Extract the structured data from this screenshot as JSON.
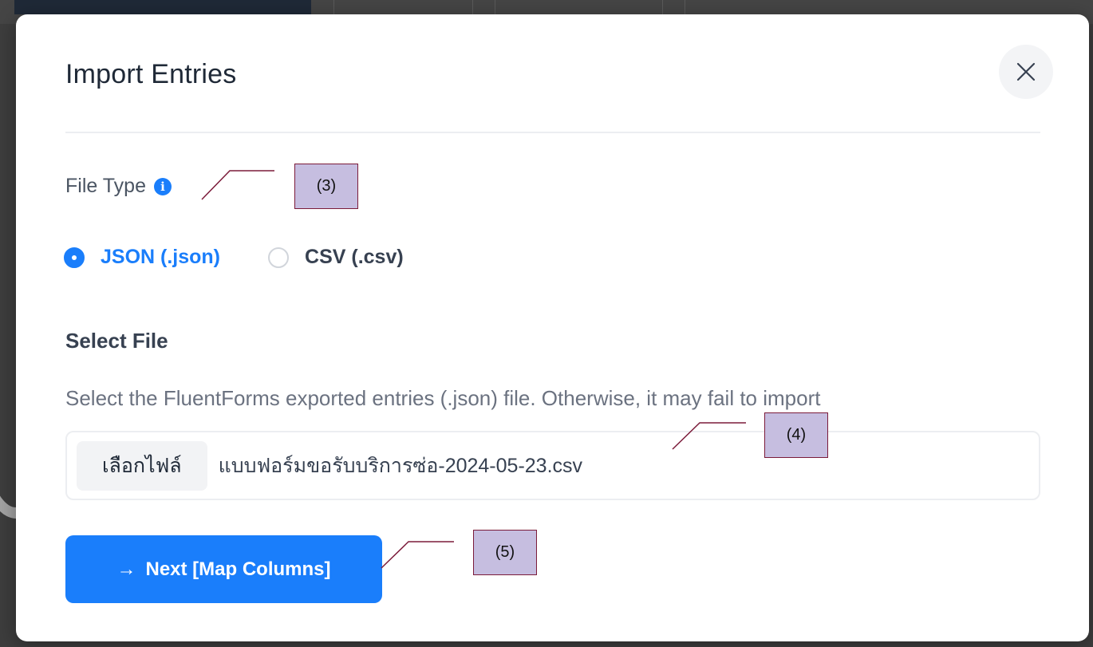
{
  "dialog": {
    "title": "Import Entries"
  },
  "file_type": {
    "label": "File Type",
    "options": [
      {
        "label": "JSON (.json)",
        "selected": true
      },
      {
        "label": "CSV (.csv)",
        "selected": false
      }
    ]
  },
  "select_file": {
    "label": "Select File",
    "help_text": "Select the FluentForms exported entries (.json) file. Otherwise, it may fail to import",
    "choose_button_label": "เลือกไฟล์",
    "file_name": "แบบฟอร์มขอรับบริการซ่อ-2024-05-23.csv"
  },
  "next_button": {
    "arrow": "→",
    "label": "Next [Map Columns]"
  },
  "annotations": {
    "file_type_callout": "(3)",
    "file_input_callout": "(4)",
    "next_button_callout": "(5)"
  },
  "colors": {
    "primary": "#1a7efb",
    "callout_fill": "#c6bee0",
    "callout_border": "#7b1b3a"
  },
  "icons": {
    "close": "close-icon",
    "info": "info-icon",
    "next_arrow": "arrow-right-icon"
  }
}
